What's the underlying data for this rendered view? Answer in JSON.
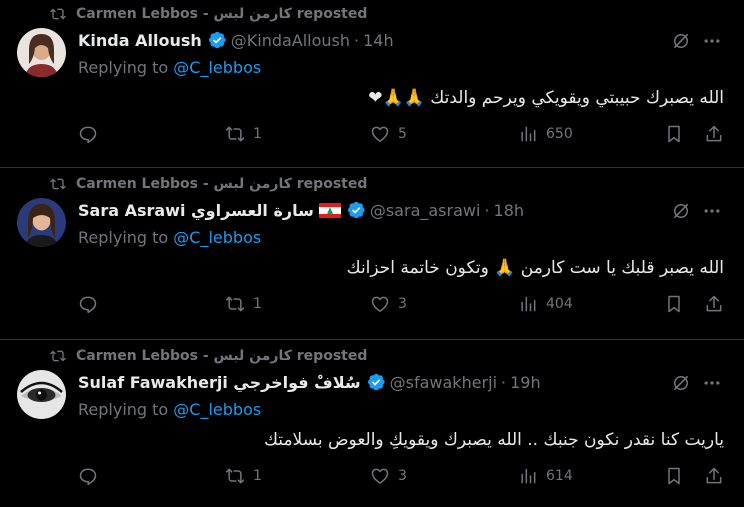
{
  "tweets": [
    {
      "repost_text": "Carmen Lebbos - كارمن لبس reposted",
      "name": "Kinda Alloush",
      "flag": false,
      "handle": "@KindaAlloush",
      "dot": "·",
      "time": "14h",
      "replying_prefix": "Replying to ",
      "replying_to": "@C_lebbos",
      "text": "الله يصبرك حبيبتي ويقويكي ويرحم والدتك 🙏🙏❤",
      "replies": "",
      "reposts": "1",
      "likes": "5",
      "views": "650",
      "avatar_color": "#6b4a3a"
    },
    {
      "repost_text": "Carmen Lebbos - كارمن لبس reposted",
      "name": "Sara Asrawi سارة العسراوي",
      "flag": true,
      "handle": "@sara_asrawi",
      "dot": "·",
      "time": "18h",
      "replying_prefix": "Replying to ",
      "replying_to": "@C_lebbos",
      "text": "الله يصبر قلبك يا ست كارمن 🙏 وتكون خاتمة احزانك",
      "replies": "",
      "reposts": "1",
      "likes": "3",
      "views": "404",
      "avatar_color": "#3b3f8a"
    },
    {
      "repost_text": "Carmen Lebbos - كارمن لبس reposted",
      "name": "Sulaf Fawakherji سُلافْ فواخرجي",
      "flag": false,
      "handle": "@sfawakherji",
      "dot": "·",
      "time": "19h",
      "replying_prefix": "Replying to ",
      "replying_to": "@C_lebbos",
      "text": "ياريت كنا نقدر نكون جنبك .. الله يصبرك ويقويكِ والعوض بسلامتك",
      "replies": "",
      "reposts": "1",
      "likes": "3",
      "views": "614",
      "avatar_color": "#d8d8d8"
    }
  ],
  "colors": {
    "accent": "#1d9bf0",
    "muted": "#71767b",
    "text": "#e7e9ea",
    "divider": "#2f3336"
  }
}
